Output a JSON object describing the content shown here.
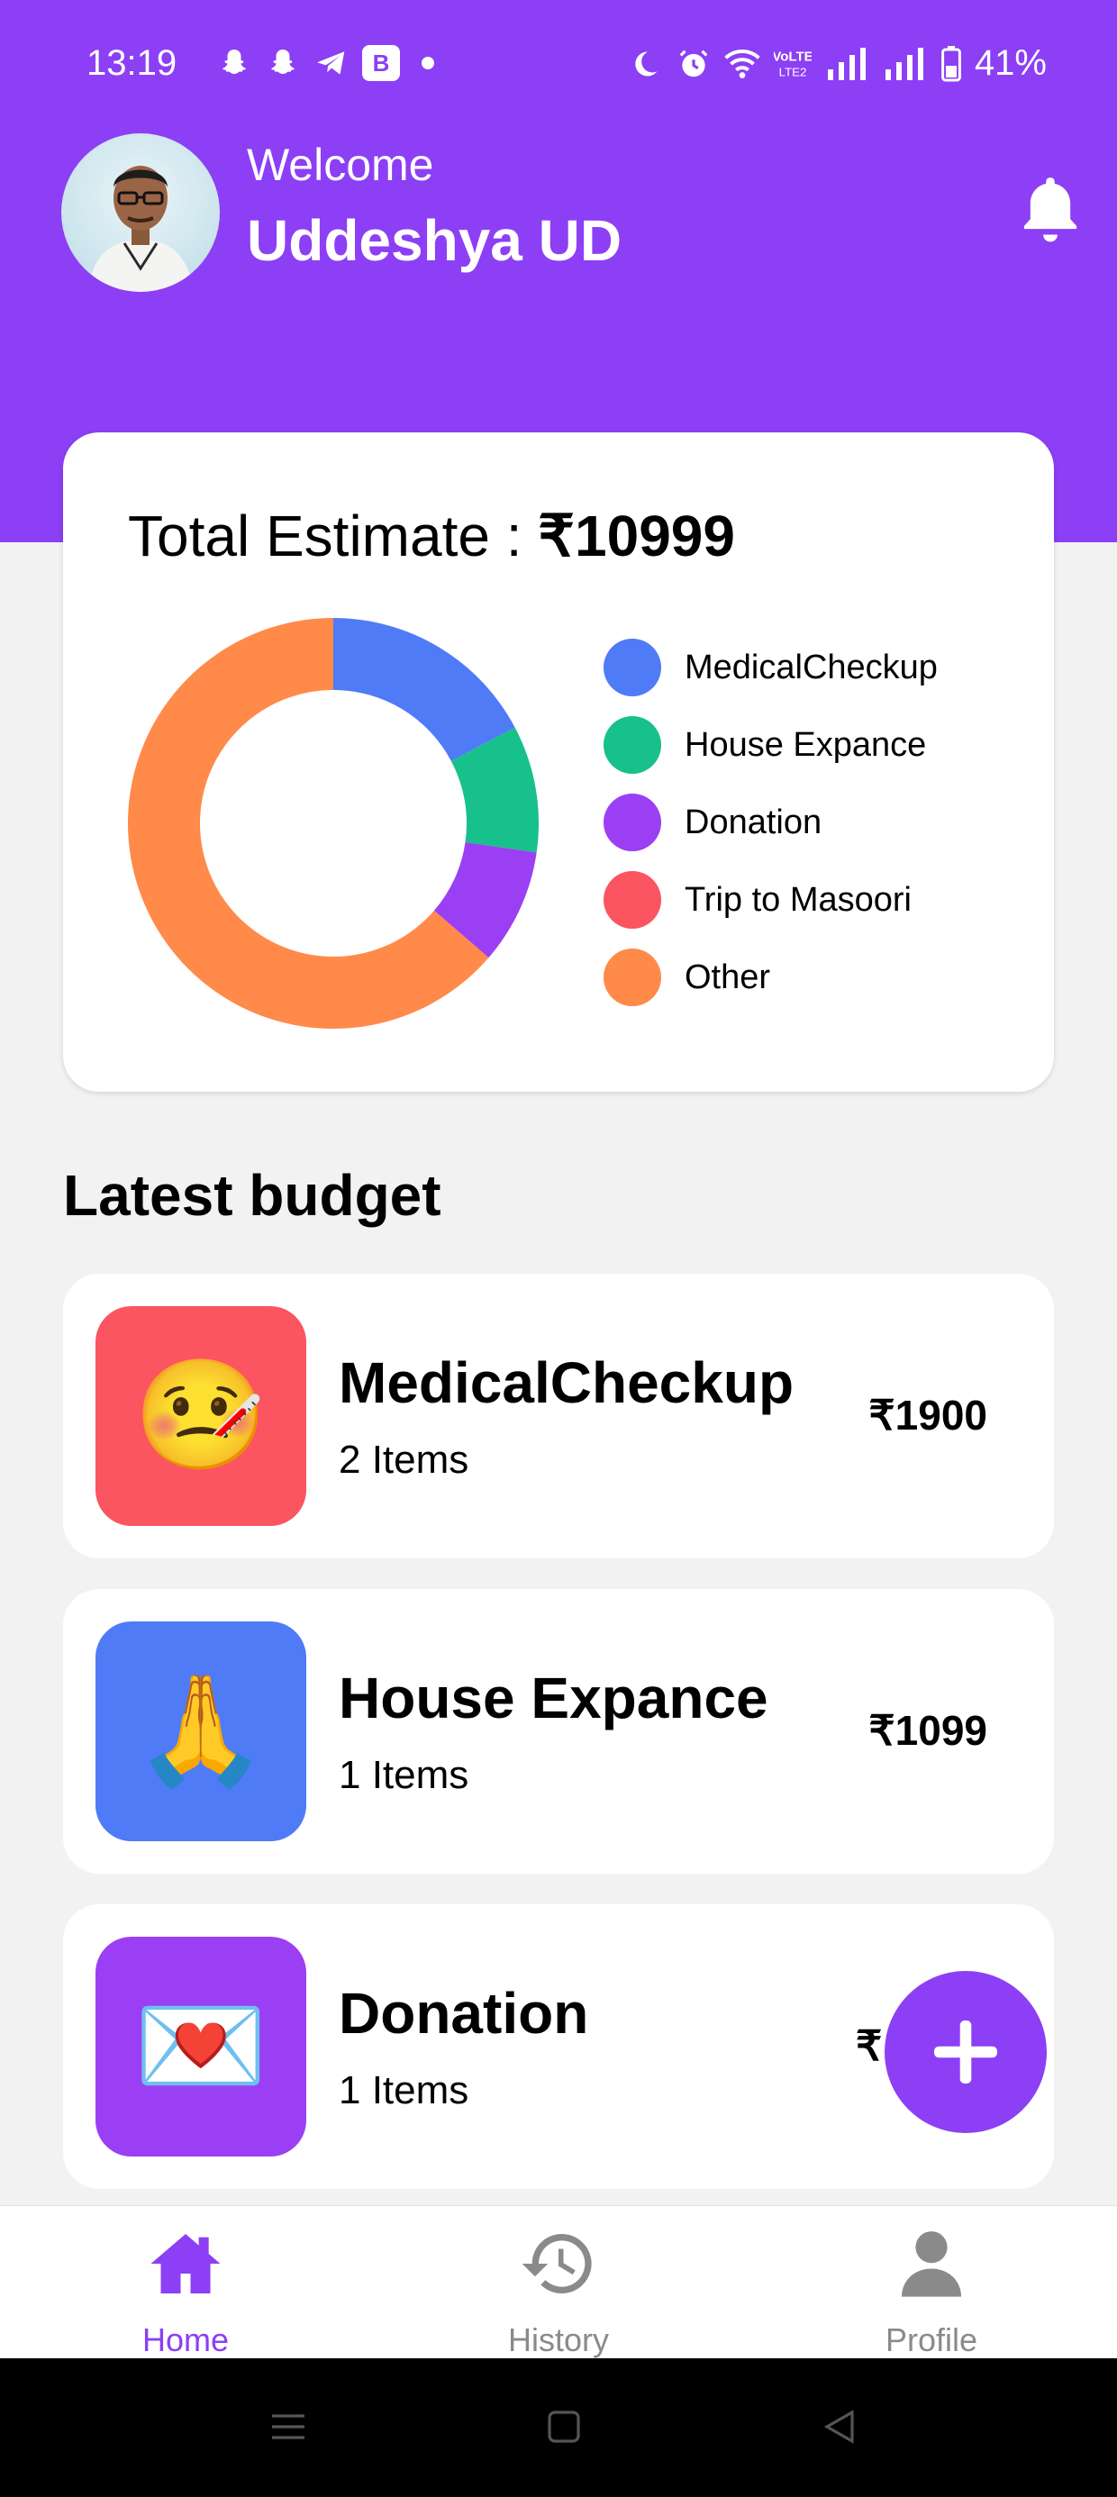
{
  "colors": {
    "brand": "#8c3ff4",
    "blue": "#4f7bf7",
    "green": "#18c08b",
    "purple": "#9b3ff4",
    "red": "#fa5560",
    "orange": "#ff8a4a",
    "inactive": "#8a8a8a"
  },
  "status_bar": {
    "time": "13:19",
    "battery": "41%"
  },
  "header": {
    "welcome": "Welcome",
    "user_name": "Uddeshya UD"
  },
  "estimate": {
    "label": "Total Estimate : ",
    "total": "₹10999"
  },
  "chart_data": {
    "type": "pie",
    "title": "",
    "categories": [
      "MedicalCheckup",
      "House Expance",
      "Donation",
      "Trip to Masoori",
      "Other"
    ],
    "values": [
      1900,
      1099,
      999,
      0,
      7001
    ],
    "colors": [
      "#4f7bf7",
      "#18c08b",
      "#9b3ff4",
      "#fa5560",
      "#ff8a4a"
    ],
    "legend_position": "right"
  },
  "latest_budget": {
    "title": "Latest budget",
    "items": [
      {
        "name": "MedicalCheckup",
        "count": "2 Items",
        "amount": "₹1900",
        "icon": "thermometer-face-icon",
        "emoji": "🤒",
        "bg": "#fa5560"
      },
      {
        "name": "House Expance",
        "count": "1 Items",
        "amount": "₹1099",
        "icon": "folded-hands-icon",
        "emoji": "🙏",
        "bg": "#4f7bf7"
      },
      {
        "name": "Donation",
        "count": "1 Items",
        "amount": "₹",
        "icon": "love-letter-icon",
        "emoji": "💌",
        "bg": "#9b3ff4"
      }
    ]
  },
  "bottom_nav": {
    "items": [
      {
        "label": "Home",
        "icon": "home-icon"
      },
      {
        "label": "History",
        "icon": "history-icon"
      },
      {
        "label": "Profile",
        "icon": "profile-icon"
      }
    ]
  }
}
